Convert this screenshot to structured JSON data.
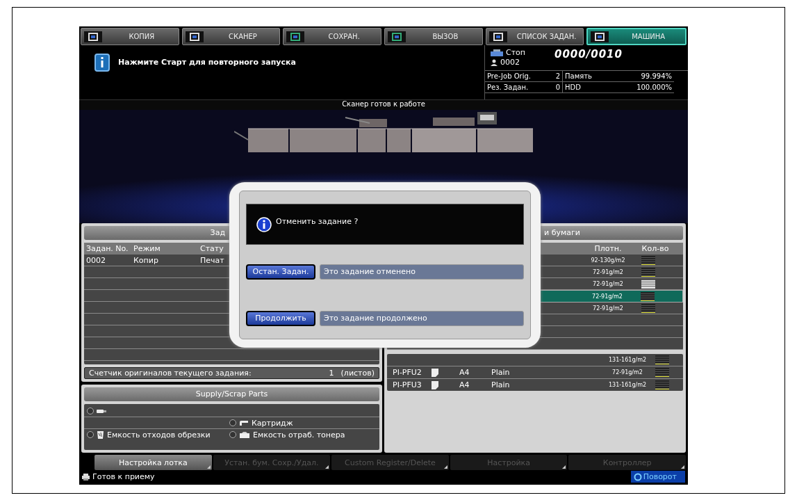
{
  "top_tabs": [
    {
      "label": "КОПИЯ",
      "selected": false
    },
    {
      "label": "СКАНЕР",
      "selected": false
    },
    {
      "label": "СОХРАН.",
      "selected": false
    },
    {
      "label": "ВЫЗОВ",
      "selected": false
    },
    {
      "label": "СПИСОК ЗАДАН.",
      "selected": false
    },
    {
      "label": "МАШИНА",
      "selected": true
    }
  ],
  "message": "Нажмите Старт для повторного запуска",
  "machine_status": {
    "state": "Стоп",
    "counter": "0000/0010",
    "user": "0002"
  },
  "status_table": [
    [
      "Pre-Job Orig.",
      "2",
      "Память",
      "99.994%"
    ],
    [
      "Рез. Задан.",
      "0",
      "HDD",
      "100.000%"
    ]
  ],
  "scanner_status": "Сканер готов к работе",
  "jobs_panel": {
    "title": "Зад",
    "columns": [
      "Задан. No.",
      "Режим",
      "Стату"
    ],
    "rows": [
      [
        "0002",
        "Копир",
        "Печат"
      ]
    ],
    "counter_label": "Счетчик оригиналов текущего задания:",
    "counter_value": "1",
    "counter_unit": "(листов)"
  },
  "supply_panel": {
    "title": "Supply/Scrap Parts",
    "rows": [
      {
        "left": {
          "kind": "toner"
        }
      },
      {
        "right": {
          "kind": "cartridge",
          "label": "Картридж"
        }
      },
      {
        "left": {
          "kind": "trim",
          "label": "Емкость отходов обрезки"
        },
        "right": {
          "kind": "waste",
          "label": "Емкость отраб. тонера"
        }
      }
    ]
  },
  "paper_panel": {
    "title": "и бумаги",
    "columns": [
      "Плотн.",
      "Кол-во"
    ],
    "trays": [
      {
        "weight": "92-130g/m2",
        "low": true,
        "selected": false
      },
      {
        "weight": "72-91g/m2",
        "low": true,
        "selected": false
      },
      {
        "weight": "72-91g/m2",
        "low": false,
        "selected": false
      },
      {
        "weight": "72-91g/m2",
        "low": true,
        "selected": true
      },
      {
        "weight": "72-91g/m2",
        "low": true,
        "selected": false
      }
    ],
    "bypass": [
      {
        "weight": "131-161g/m2",
        "low": true
      },
      {
        "tray": "PI-PFU2",
        "size": "A4",
        "type": "Plain",
        "weight": "72-91g/m2",
        "low": true
      },
      {
        "tray": "PI-PFU3",
        "size": "A4",
        "type": "Plain",
        "weight": "131-161g/m2",
        "low": true
      }
    ]
  },
  "dialog": {
    "message": "Отменить задание ?",
    "actions": [
      {
        "button": "Остан. Задан.",
        "description": "Это задание отменено"
      },
      {
        "button": "Продолжить",
        "description": "Это задание продолжено"
      }
    ]
  },
  "bottom_tabs": [
    {
      "label": "Настройка лотка",
      "disabled": false
    },
    {
      "label": "Устан. бум. Сохр./Удал.",
      "disabled": true
    },
    {
      "label": "Custom Register/Delete",
      "disabled": true
    },
    {
      "label": "Настройка",
      "disabled": true
    },
    {
      "label": "Контроллер",
      "disabled": true
    }
  ],
  "status_bar": {
    "text": "Готов к приему",
    "rotate": "Поворот"
  }
}
